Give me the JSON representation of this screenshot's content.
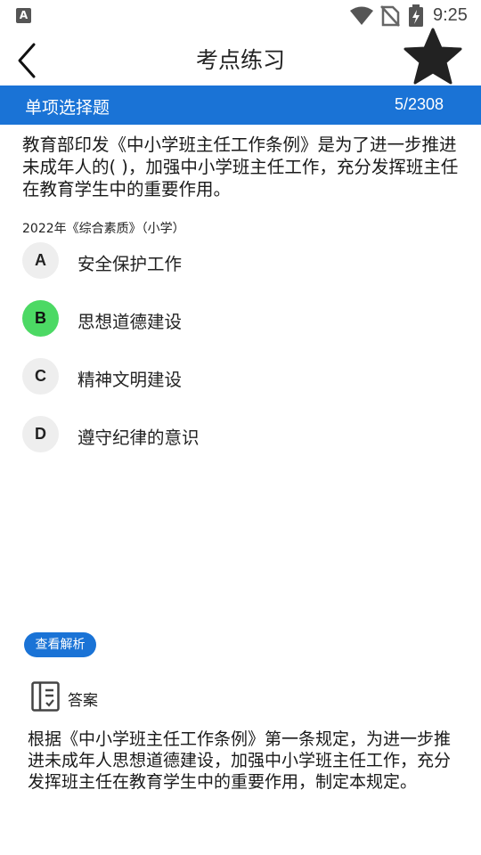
{
  "status_bar": {
    "time": "9:25",
    "notification_glyph": "A"
  },
  "header": {
    "title": "考点练习"
  },
  "question_bar": {
    "type_label": "单项选择题",
    "progress": "5/2308"
  },
  "question": {
    "text": "教育部印发《中小学班主任工作条例》是为了进一步推进未成年人的(    )，加强中小学班主任工作，充分发挥班主任在教育学生中的重要作用。",
    "source": "2022年《综合素质》（小学）"
  },
  "options": [
    {
      "letter": "A",
      "text": "安全保护工作",
      "selected": false
    },
    {
      "letter": "B",
      "text": "思想道德建设",
      "selected": true
    },
    {
      "letter": "C",
      "text": "精神文明建设",
      "selected": false
    },
    {
      "letter": "D",
      "text": "遵守纪律的意识",
      "selected": false
    }
  ],
  "analysis": {
    "button_label": "查看解析"
  },
  "answer": {
    "label": "答案",
    "explanation": "根据《中小学班主任工作条例》第一条规定，为进一步推进未成年人思想道德建设，加强中小学班主任工作，充分发挥班主任在教育学生中的重要作用，制定本规定。"
  },
  "colors": {
    "accent": "#1a73d6",
    "selected": "#4cd964",
    "option_bg": "#eeeeee"
  }
}
